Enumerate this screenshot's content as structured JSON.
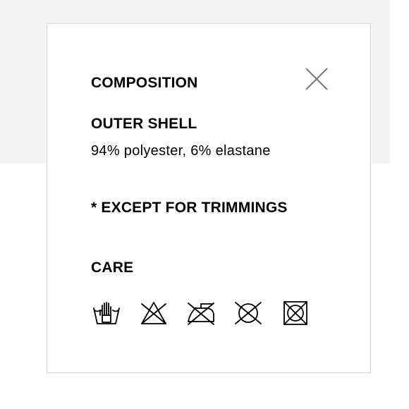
{
  "composition": {
    "title": "COMPOSITION",
    "outer_shell_heading": "OUTER SHELL",
    "outer_shell_materials": "94% polyester, 6% elastane",
    "exception_note": "* EXCEPT FOR TRIMMINGS"
  },
  "care": {
    "title": "CARE",
    "icons": [
      "hand-wash-icon",
      "do-not-bleach-icon",
      "do-not-iron-icon",
      "do-not-dry-clean-icon",
      "do-not-tumble-dry-icon"
    ]
  },
  "close_icon": "close-icon",
  "colors": {
    "text": "#000000",
    "close_icon": "#7a7a7a",
    "border": "#d6d6d6",
    "backdrop_band": "#f4f4f4"
  }
}
